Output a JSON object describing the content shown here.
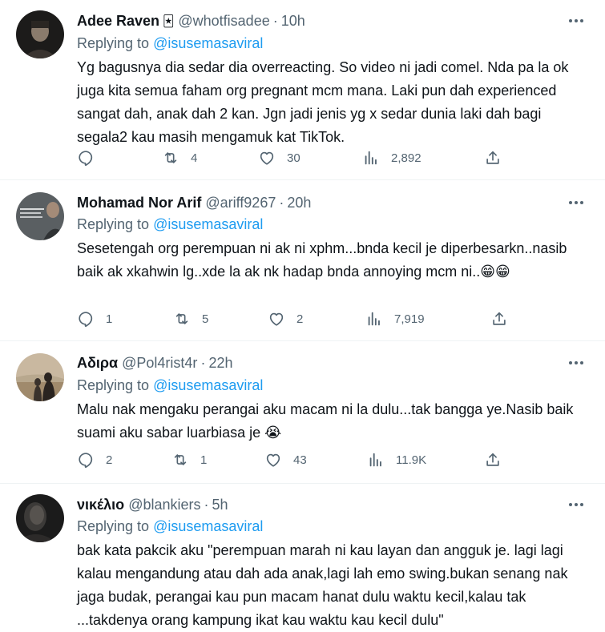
{
  "tweets": [
    {
      "name": "Adee Raven",
      "badge": "🃏",
      "handle": "@whotfisadee",
      "time": "10h",
      "replying_label": "Replying to",
      "replying_to": "@isusemasaviral",
      "text": "Yg bagusnya dia sedar dia overreacting. So video ni jadi comel. Nda pa la ok juga kita semua faham org pregnant mcm mana. Laki pun dah experienced sangat dah, anak dah 2 kan. Jgn jadi jenis yg x sedar dunia laki dah bagi segala2 kau masih mengamuk kat TikTok.",
      "replies": "",
      "retweets": "4",
      "likes": "30",
      "views": "2,892"
    },
    {
      "name": "Mohamad Nor Arif",
      "badge": "",
      "handle": "@ariff9267",
      "time": "20h",
      "replying_label": "Replying to",
      "replying_to": "@isusemasaviral",
      "text": "Sesetengah org perempuan ni ak ni xphm...bnda kecil je diperbesarkn..nasib baik ak xkahwin lg..xde la ak nk hadap bnda annoying mcm ni..😁😁",
      "replies": "1",
      "retweets": "5",
      "likes": "2",
      "views": "7,919"
    },
    {
      "name": "Αδιρα",
      "badge": "",
      "handle": "@Pol4rist4r",
      "time": "22h",
      "replying_label": "Replying to",
      "replying_to": "@isusemasaviral",
      "text": "Malu nak mengaku perangai aku macam ni la dulu...tak bangga ye.Nasib baik suami aku sabar luarbiasa je 😭",
      "replies": "2",
      "retweets": "1",
      "likes": "43",
      "views": "11.9K"
    },
    {
      "name": "νικέλιο",
      "badge": "",
      "handle": "@blankiers",
      "time": "5h",
      "replying_label": "Replying to",
      "replying_to": "@isusemasaviral",
      "text": "bak kata pakcik aku \"perempuan marah ni kau layan dan angguk je. lagi lagi kalau mengandung atau dah ada anak,lagi lah emo swing.bukan senang nak jaga budak, perangai kau pun macam hanat dulu waktu kecil,kalau tak ...takdenya orang kampung ikat kau waktu kau kecil dulu\"",
      "replies": "",
      "retweets": "",
      "likes": "",
      "views": ""
    }
  ],
  "separator": "·",
  "colors": {
    "text": "#0f1419",
    "secondary": "#536471",
    "link": "#1d9bf0",
    "border": "#eff3f4"
  },
  "icons": [
    "reply-icon",
    "retweet-icon",
    "like-icon",
    "views-icon",
    "share-icon",
    "more-icon"
  ]
}
